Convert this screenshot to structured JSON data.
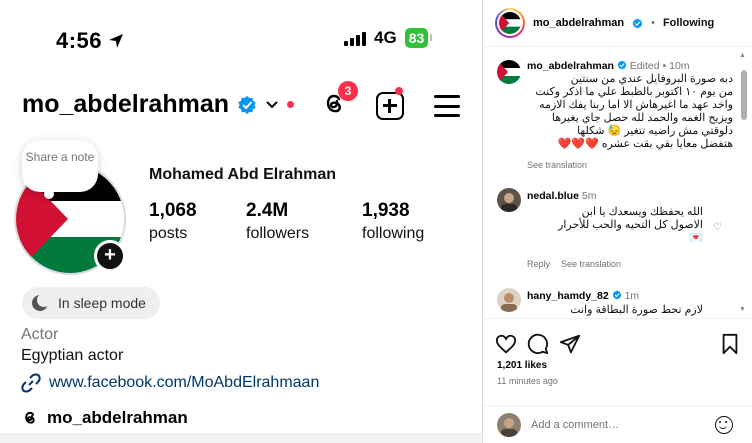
{
  "status_bar": {
    "time": "4:56",
    "network": "4G",
    "battery": "83"
  },
  "profile": {
    "username": "mo_abdelrahman",
    "threads_badge": "3",
    "note_placeholder": "Share a note",
    "full_name": "Mohamed Abd Elrahman",
    "stats": [
      {
        "value": "1,068",
        "label": "posts"
      },
      {
        "value": "2.4M",
        "label": "followers"
      },
      {
        "value": "1,938",
        "label": "following"
      }
    ],
    "sleep_mode": "In sleep mode",
    "category": "Actor",
    "bio": "Egyptian actor",
    "link": "www.facebook.com/MoAbdElrahmaan",
    "threads_handle": "mo_abdelrahman"
  },
  "post": {
    "header": {
      "username": "mo_abdelrahman",
      "separator": "•",
      "follow_state": "Following"
    },
    "caption": {
      "username": "mo_abdelrahman",
      "edited": "Edited",
      "time": "10m",
      "lines": [
        "دبه صورة البروفايل عندي من سنتين",
        "من يوم ١٠ اكتوبر بالظبط علي ما اذكر وكنت",
        "واخد عهد ما اغيرهاش الا اما ربنا يفك الازمه",
        "ويزيح الغمه والحمد لله حصل جاي يغيرها",
        "دلوقتي مش راضيه تتغير 😓 شكلها",
        "هتفضل معايا بقي بقت عشره ❤️❤️❤️"
      ],
      "see_translation": "See translation"
    },
    "comments": [
      {
        "username": "nedal.blue",
        "time": "5m",
        "lines": [
          "الله يحفظك ويسعدك يا ابن",
          "الاصول كل التحيه والحب للأحرار",
          "💌"
        ],
        "reply": "Reply",
        "see_translation": "See translation"
      },
      {
        "username": "hany_hamdy_82",
        "time": "1m",
        "lines": [
          "لازم تحط صورة البطاقة وانت"
        ]
      }
    ],
    "likes": "1,201 likes",
    "time_ago": "11 minutes ago",
    "add_comment_placeholder": "Add a comment…"
  },
  "colors": {
    "flag_red": "#d21034",
    "flag_black": "#000000",
    "flag_green": "#007a3d",
    "verified_blue": "#0095f6",
    "notification_red": "#ff2e4a",
    "battery_green": "#30c03a"
  },
  "icons": [
    "location-arrow-icon",
    "threads-icon",
    "add-post-icon",
    "menu-icon",
    "link-icon",
    "heart-icon",
    "comment-icon",
    "share-icon",
    "save-icon",
    "emoji-icon",
    "verified-icon",
    "moon-icon"
  ]
}
